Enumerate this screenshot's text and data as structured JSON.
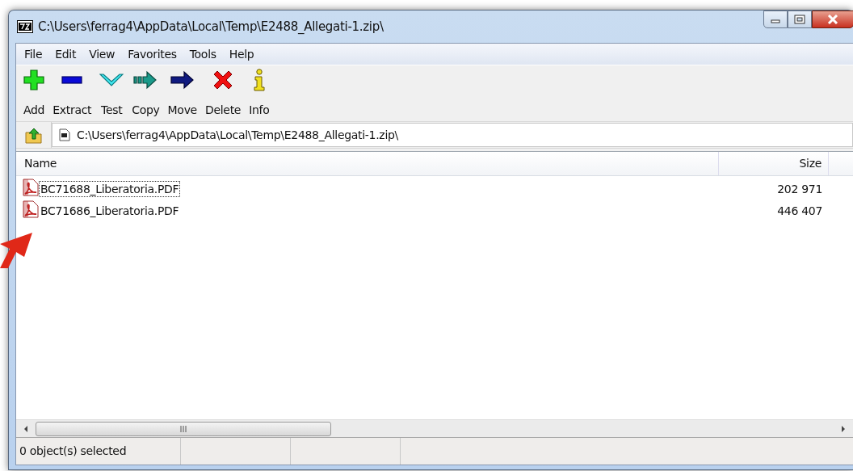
{
  "window": {
    "title": "C:\\Users\\ferrag4\\AppData\\Local\\Temp\\E2488_Allegati-1.zip\\"
  },
  "menu": [
    "File",
    "Edit",
    "View",
    "Favorites",
    "Tools",
    "Help"
  ],
  "toolbar": [
    {
      "kind": "add",
      "label": "Add"
    },
    {
      "kind": "extract",
      "label": "Extract"
    },
    {
      "kind": "test",
      "label": "Test"
    },
    {
      "kind": "copy",
      "label": "Copy"
    },
    {
      "kind": "move",
      "label": "Move"
    },
    {
      "kind": "delete",
      "label": "Delete"
    },
    {
      "kind": "info",
      "label": "Info"
    }
  ],
  "address": {
    "value": "C:\\Users\\ferrag4\\AppData\\Local\\Temp\\E2488_Allegati-1.zip\\"
  },
  "table": {
    "columns": [
      "Name",
      "Size"
    ],
    "rows": [
      {
        "name": "BC71688_Liberatoria.PDF",
        "size": "202 971",
        "focused": true
      },
      {
        "name": "BC71686_Liberatoria.PDF",
        "size": "446 407",
        "focused": false
      }
    ]
  },
  "status_bar": {
    "text": "0 object(s) selected"
  }
}
